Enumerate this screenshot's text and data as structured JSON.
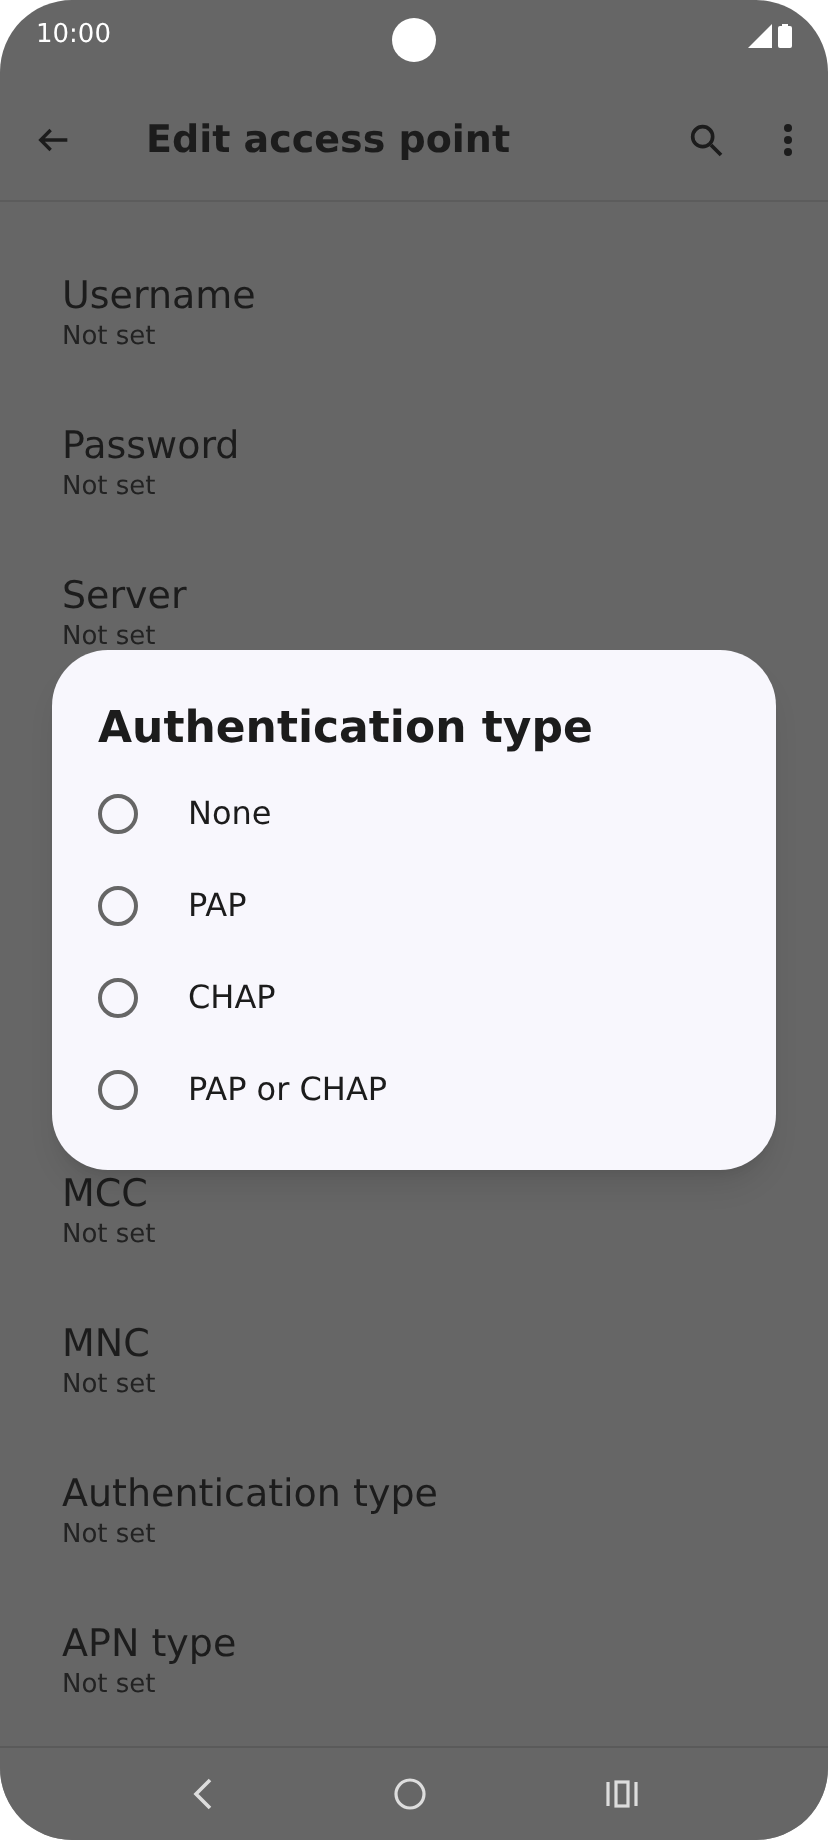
{
  "status_bar": {
    "time": "10:00"
  },
  "toolbar": {
    "title": "Edit access point"
  },
  "settings_top": [
    {
      "title": "Username",
      "value": "Not set"
    },
    {
      "title": "Password",
      "value": "Not set"
    },
    {
      "title": "Server",
      "value": "Not set"
    }
  ],
  "settings_bottom": [
    {
      "title": "MCC",
      "value": "Not set"
    },
    {
      "title": "MNC",
      "value": "Not set"
    },
    {
      "title": "Authentication type",
      "value": "Not set"
    },
    {
      "title": "APN type",
      "value": "Not set"
    }
  ],
  "dialog": {
    "title": "Authentication type",
    "options": [
      {
        "label": "None",
        "selected": false
      },
      {
        "label": "PAP",
        "selected": false
      },
      {
        "label": "CHAP",
        "selected": false
      },
      {
        "label": "PAP or CHAP",
        "selected": false
      }
    ]
  }
}
